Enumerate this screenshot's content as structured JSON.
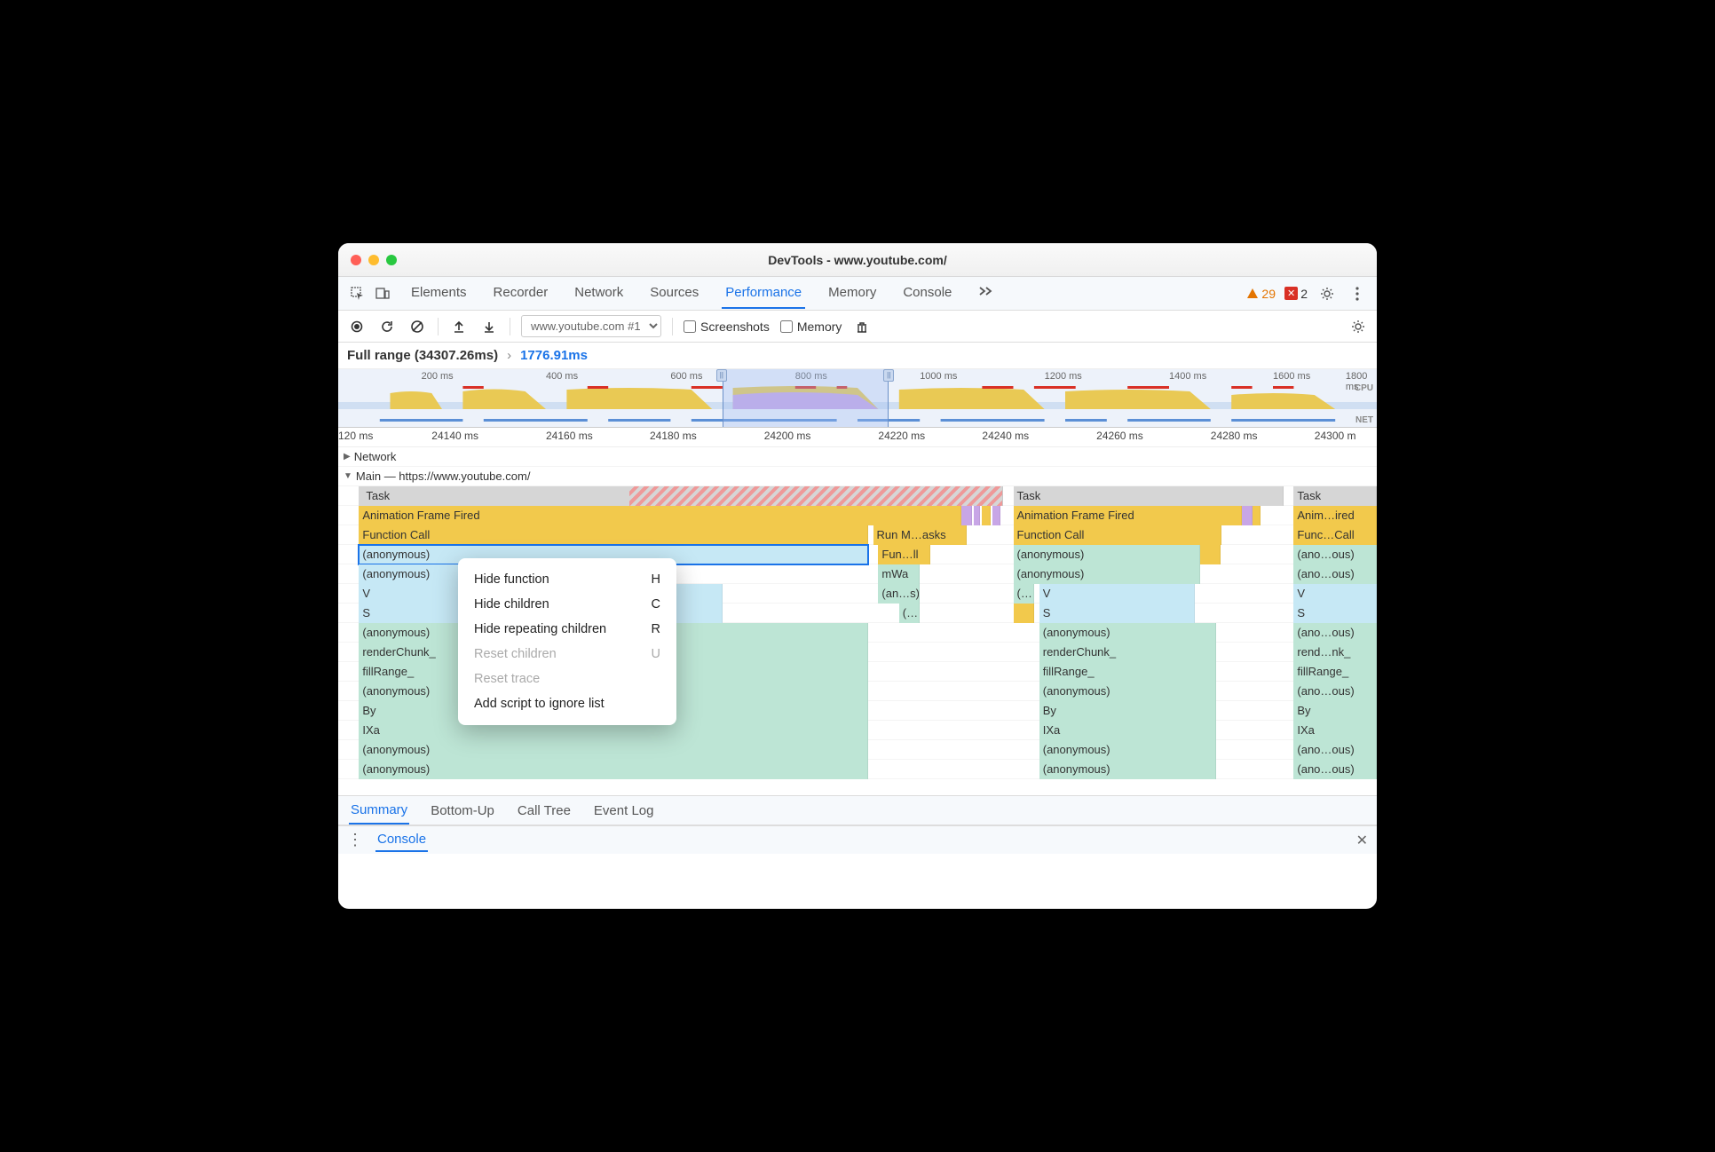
{
  "window": {
    "title": "DevTools - www.youtube.com/"
  },
  "mainTabs": [
    "Elements",
    "Recorder",
    "Network",
    "Sources",
    "Performance",
    "Memory",
    "Console"
  ],
  "mainTabsActive": "Performance",
  "issues": {
    "warnings": 29,
    "errors": 2
  },
  "toolbar": {
    "profile": "www.youtube.com #1",
    "screenshots": "Screenshots",
    "memory": "Memory"
  },
  "breadcrumb": {
    "full": "Full range (34307.26ms)",
    "selected": "1776.91ms"
  },
  "overview": {
    "ticks": [
      "200 ms",
      "400 ms",
      "600 ms",
      "800 ms",
      "1000 ms",
      "1200 ms",
      "1400 ms",
      "1600 ms",
      "1800 ms"
    ],
    "cpuLabel": "CPU",
    "netLabel": "NET"
  },
  "ruler": [
    "120 ms",
    "24140 ms",
    "24160 ms",
    "24180 ms",
    "24200 ms",
    "24220 ms",
    "24240 ms",
    "24260 ms",
    "24280 ms",
    "24300 m"
  ],
  "tree": {
    "network": "Network",
    "main": "Main — https://www.youtube.com/",
    "rows": [
      {
        "labels": [
          "Task",
          "Task",
          "Task"
        ]
      },
      {
        "labels": [
          "Animation Frame Fired",
          "Animation Frame Fired",
          "Anim…ired"
        ]
      },
      {
        "labels": [
          "Function Call",
          "Run M…asks",
          "Function Call",
          "Func…Call"
        ]
      },
      {
        "labels": [
          "(anonymous)",
          "Fun…ll",
          "(anonymous)",
          "(ano…ous)"
        ]
      },
      {
        "labels": [
          "(anonymous)",
          "mWa",
          "(anonymous)",
          "(ano…ous)"
        ]
      },
      {
        "labels": [
          "V",
          "(an…s)",
          "(…",
          "V",
          "V"
        ]
      },
      {
        "labels": [
          "S",
          "(…",
          "S",
          "S"
        ]
      },
      {
        "labels": [
          "(anonymous)",
          "(anonymous)",
          "(ano…ous)"
        ]
      },
      {
        "labels": [
          "renderChunk_",
          "renderChunk_",
          "rend…nk_"
        ]
      },
      {
        "labels": [
          "fillRange_",
          "fillRange_",
          "fillRange_"
        ]
      },
      {
        "labels": [
          "(anonymous)",
          "(anonymous)",
          "(ano…ous)"
        ]
      },
      {
        "labels": [
          "By",
          "By",
          "By"
        ]
      },
      {
        "labels": [
          "IXa",
          "IXa",
          "IXa"
        ]
      },
      {
        "labels": [
          "(anonymous)",
          "(anonymous)",
          "(ano…ous)"
        ]
      },
      {
        "labels": [
          "(anonymous)",
          "(anonymous)",
          "(ano…ous)"
        ]
      }
    ]
  },
  "detailTabs": [
    "Summary",
    "Bottom-Up",
    "Call Tree",
    "Event Log"
  ],
  "detailTabsActive": "Summary",
  "drawer": {
    "console": "Console"
  },
  "contextMenu": [
    {
      "label": "Hide function",
      "shortcut": "H",
      "enabled": true
    },
    {
      "label": "Hide children",
      "shortcut": "C",
      "enabled": true
    },
    {
      "label": "Hide repeating children",
      "shortcut": "R",
      "enabled": true
    },
    {
      "label": "Reset children",
      "shortcut": "U",
      "enabled": false
    },
    {
      "label": "Reset trace",
      "shortcut": "",
      "enabled": false
    },
    {
      "label": "Add script to ignore list",
      "shortcut": "",
      "enabled": true
    }
  ]
}
